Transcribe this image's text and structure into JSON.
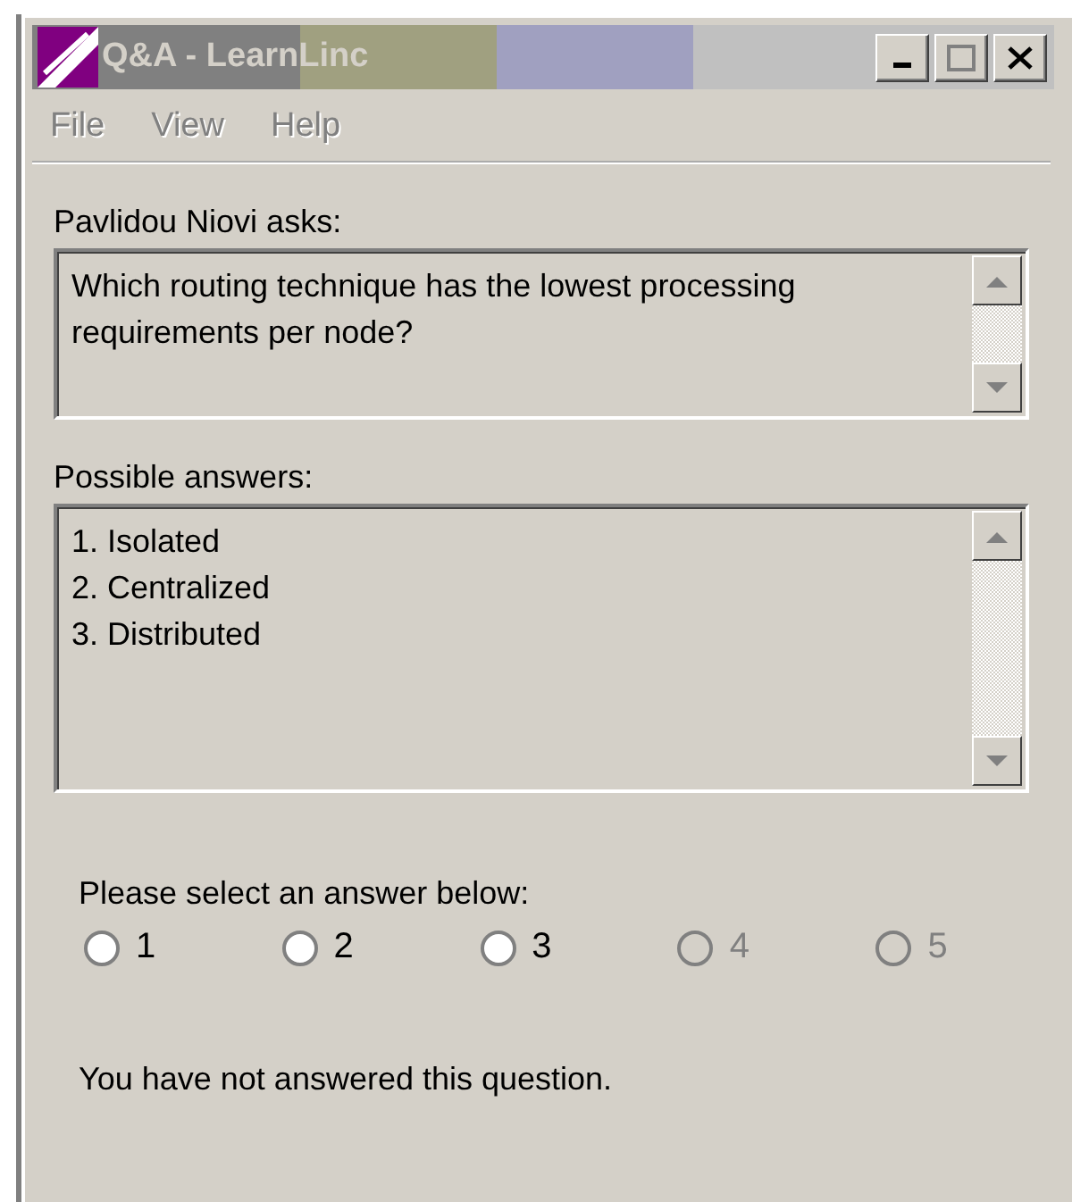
{
  "window": {
    "title": "Q&A - LearnLinc"
  },
  "menu": [
    {
      "label": "File",
      "disabled": true
    },
    {
      "label": "View",
      "disabled": true
    },
    {
      "label": "Help",
      "disabled": true
    }
  ],
  "question": {
    "label": "Pavlidou Niovi asks:",
    "text": "Which routing technique has the lowest processing requirements per node?"
  },
  "answers": {
    "label": "Possible answers:",
    "items": [
      "1. Isolated",
      "2. Centralized",
      "3. Distributed"
    ]
  },
  "selection": {
    "label": "Please select an answer below:",
    "options": [
      {
        "label": "1",
        "selected": false,
        "disabled": false
      },
      {
        "label": "2",
        "selected": false,
        "disabled": false
      },
      {
        "label": "3",
        "selected": false,
        "disabled": false
      },
      {
        "label": "4",
        "selected": false,
        "disabled": true
      },
      {
        "label": "5",
        "selected": false,
        "disabled": true
      }
    ]
  },
  "status": "You have not answered this question."
}
